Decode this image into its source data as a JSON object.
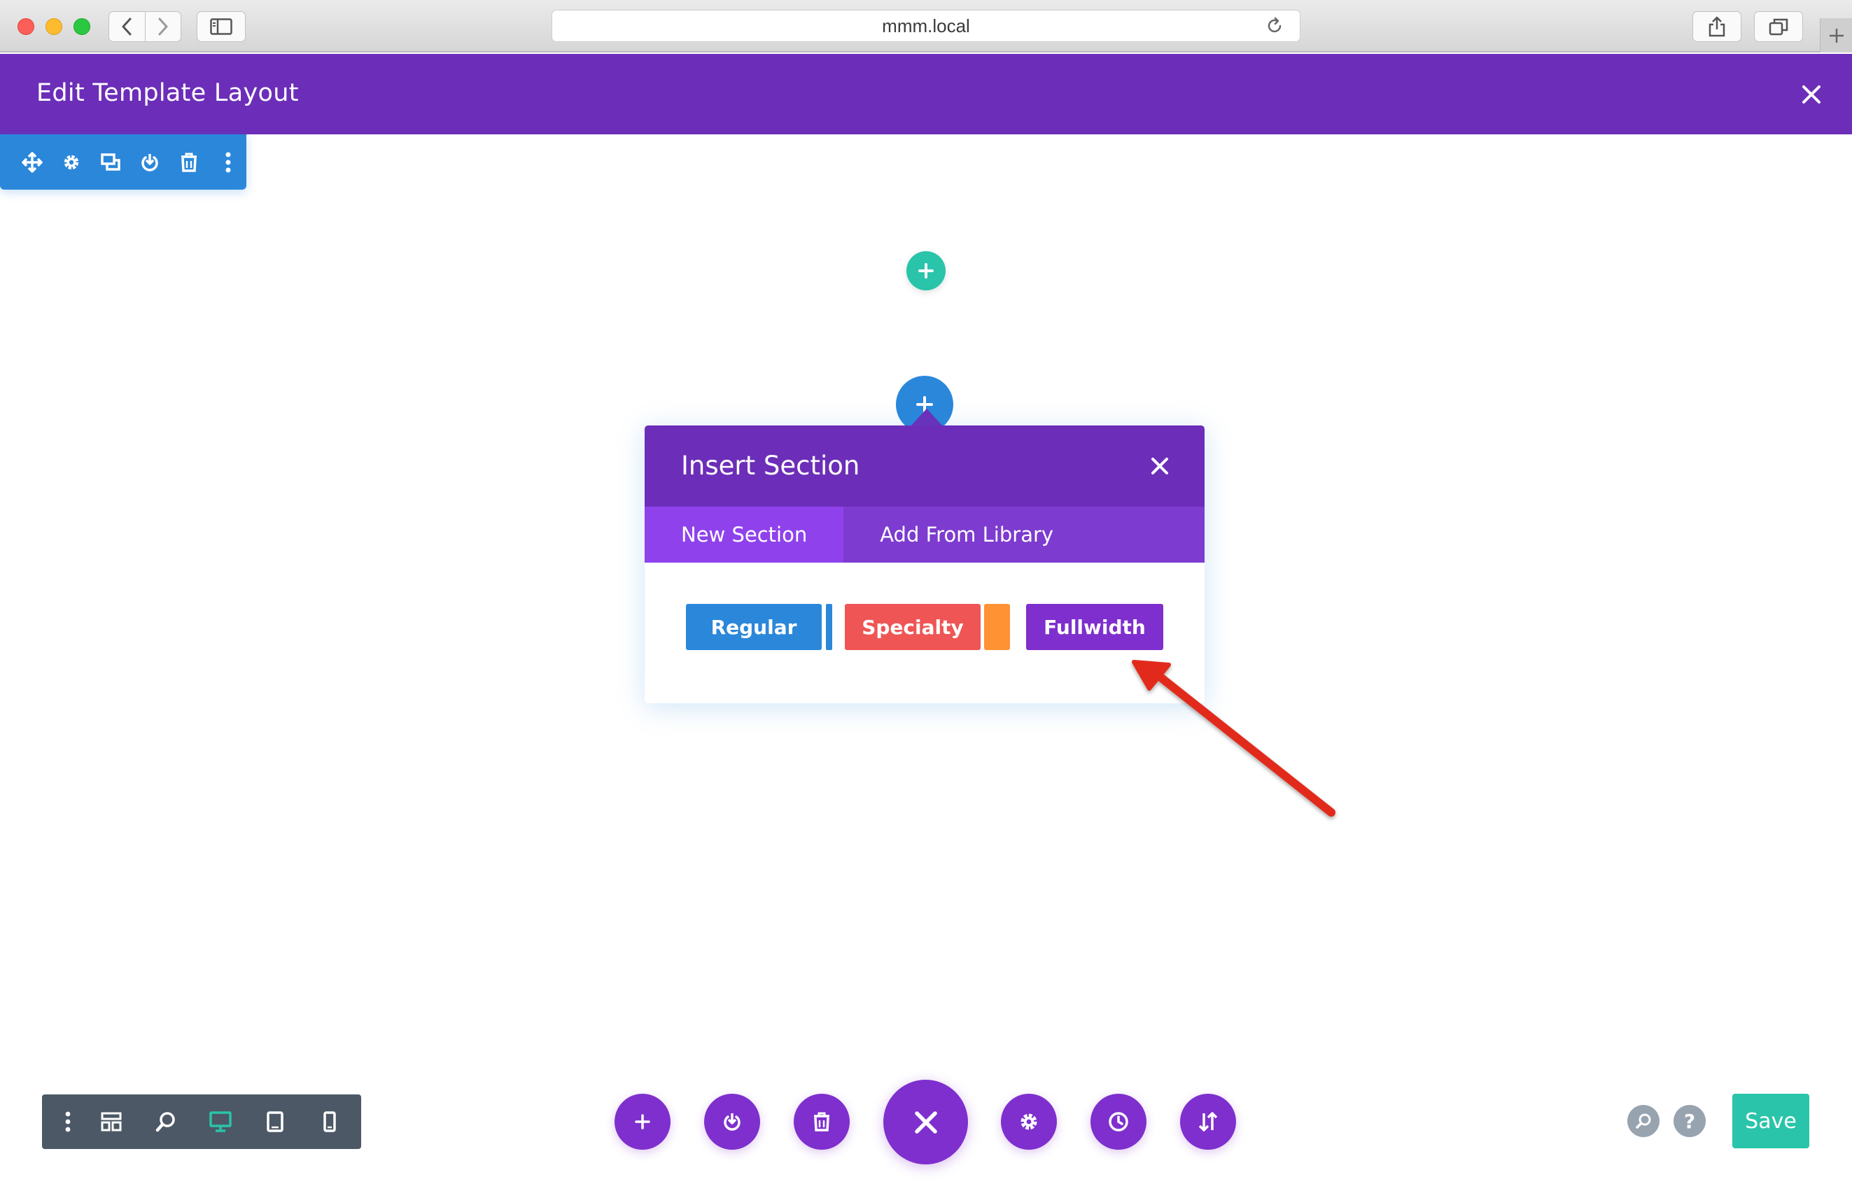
{
  "browser": {
    "url": "mmm.local",
    "icons": [
      "back-icon",
      "forward-icon",
      "sidebar-icon",
      "reload-icon",
      "share-icon",
      "tabs-icon",
      "new-tab-icon"
    ]
  },
  "header": {
    "title": "Edit Template Layout",
    "close_icon": "close-icon",
    "color": "#6c2eb9"
  },
  "section_toolbar": {
    "color": "#2b87da",
    "icons": [
      "move-icon",
      "gear-icon",
      "duplicate-icon",
      "save-to-library-icon",
      "trash-icon",
      "more-icon"
    ]
  },
  "modal": {
    "title": "Insert Section",
    "tabs": [
      {
        "label": "New Section",
        "active": true
      },
      {
        "label": "Add From Library",
        "active": false
      }
    ],
    "buttons": {
      "regular": "Regular",
      "specialty": "Specialty",
      "fullwidth": "Fullwidth"
    },
    "colors": {
      "regular": "#2b87da",
      "specialty": "#ef5555",
      "specialty_accent": "#ff9232",
      "fullwidth": "#7e2fcd"
    }
  },
  "view_toolbar": {
    "icons": [
      "more-icon",
      "layers-icon",
      "zoom-icon",
      "desktop-icon",
      "tablet-icon",
      "phone-icon"
    ],
    "active": "desktop-icon"
  },
  "page_actions": {
    "icons": [
      "add-icon",
      "save-to-library-icon",
      "trash-icon",
      "close-icon",
      "gear-icon",
      "history-icon",
      "portability-icon"
    ]
  },
  "help": {
    "search_icon": "search-icon",
    "help_label": "?"
  },
  "save_label": "Save",
  "accent_green": "#29c4a9"
}
